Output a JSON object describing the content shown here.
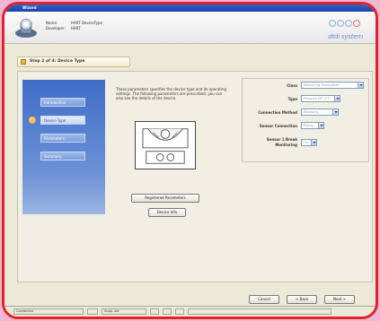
{
  "window": {
    "title": "Wizard"
  },
  "header": {
    "name_label": "Name:",
    "name_value": "HART DeviceType",
    "developer_label": "Developer:",
    "developer_value": "HART",
    "logo_text": "dtdi system"
  },
  "step": {
    "title": "Step 2 of 4: Device Type"
  },
  "sidebar": {
    "items": [
      {
        "label": "Introduction",
        "active": false
      },
      {
        "label": "Device Type",
        "active": true
      },
      {
        "label": "Parameters",
        "active": false
      },
      {
        "label": "Summary",
        "active": false
      }
    ]
  },
  "main": {
    "description": "These parameters specifies the device type and its operating settings. The following parameters are prescribed, you can also see the details of the device."
  },
  "buttons": {
    "registered_parameters": "Registered Parameters",
    "device_info": "Device Info"
  },
  "form": {
    "fields": [
      {
        "label": "Class",
        "value": "Measuring Transmitter"
      },
      {
        "label": "Type",
        "value": "Pressure DP / PT"
      },
      {
        "label": "Connection Method",
        "value": "Standard"
      },
      {
        "label": "Sensor Connection",
        "value": "Piping"
      },
      {
        "label": "Sensor 1 Break Monitoring",
        "value": "On"
      }
    ]
  },
  "footer": {
    "cancel": "Cancel",
    "back": "< Back",
    "next": "Next >"
  },
  "statusbar": {
    "cells": [
      "Connected",
      "",
      "Supp. set",
      "",
      "",
      "",
      ""
    ]
  }
}
